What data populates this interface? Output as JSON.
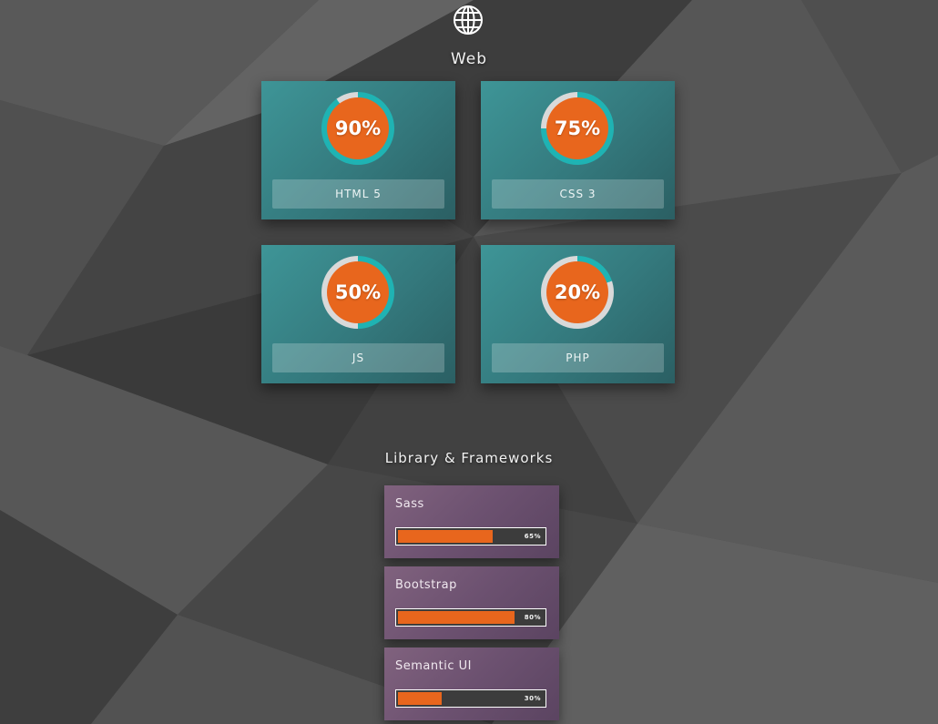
{
  "web_section": {
    "icon": "globe-icon",
    "title": "Web",
    "skills": [
      {
        "name": "HTML 5",
        "percent_label": "90%",
        "progress": 0.9
      },
      {
        "name": "CSS 3",
        "percent_label": "75%",
        "progress": 0.75
      },
      {
        "name": "JS",
        "percent_label": "50%",
        "progress": 0.5
      },
      {
        "name": "PHP",
        "percent_label": "20%",
        "progress": 0.2
      }
    ]
  },
  "library_section": {
    "title": "Library & Frameworks",
    "items": [
      {
        "name": "Sass",
        "percent_label": "65%",
        "progress": 0.65
      },
      {
        "name": "Bootstrap",
        "percent_label": "80%",
        "progress": 0.8
      },
      {
        "name": "Semantic UI",
        "percent_label": "30%",
        "progress": 0.3
      }
    ]
  },
  "colors": {
    "accent_orange": "#e8661d",
    "ring_teal": "#1fb3b3",
    "ring_track": "#d9d9d9",
    "web_card": "#34797d",
    "library_card": "#6c5170"
  }
}
